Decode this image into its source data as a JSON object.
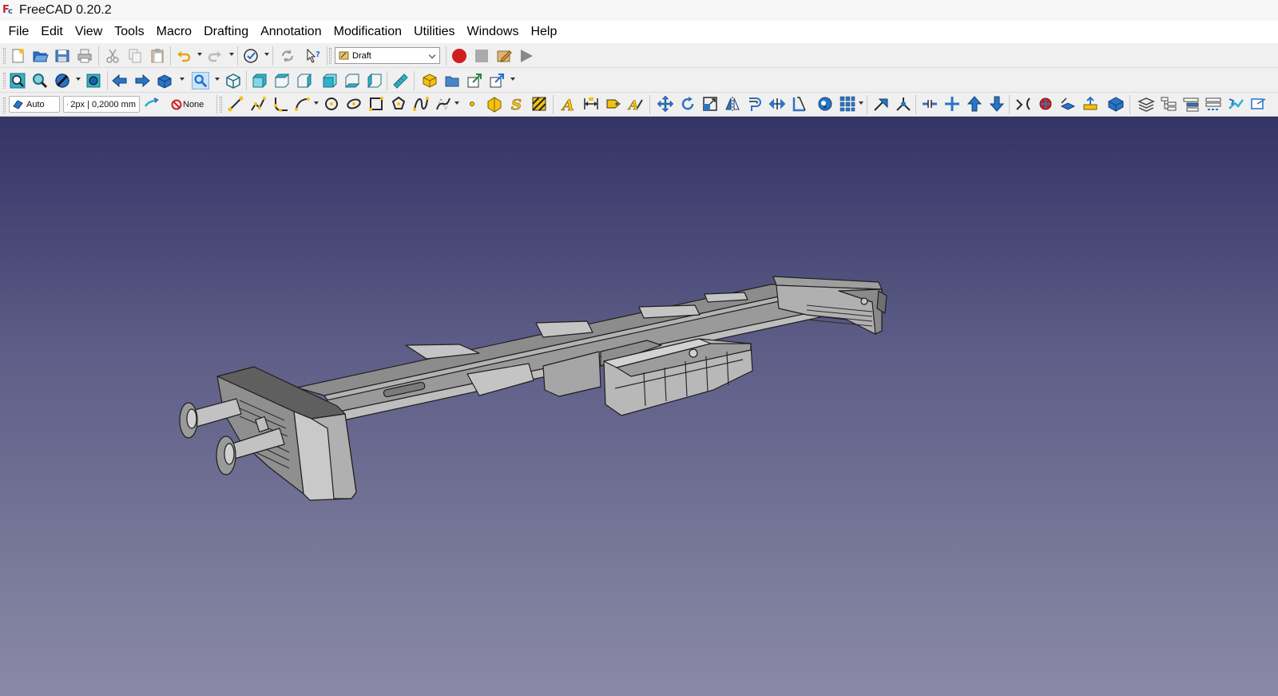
{
  "window": {
    "title": "FreeCAD 0.20.2"
  },
  "menu": [
    "File",
    "Edit",
    "View",
    "Tools",
    "Macro",
    "Drafting",
    "Annotation",
    "Modification",
    "Utilities",
    "Windows",
    "Help"
  ],
  "workbench": {
    "selected": "Draft"
  },
  "draft_tray": {
    "plane_label": "Auto",
    "style_label": "2px | 0,2000 mm",
    "group_label": "None"
  },
  "toolbars": {
    "file": [
      "new-document-icon",
      "open-icon",
      "save-icon",
      "print-icon",
      "cut-icon",
      "copy-icon",
      "paste-icon",
      "undo-icon",
      "redo-icon",
      "refresh-icon",
      "whats-this-icon"
    ],
    "macro": [
      "macro-record-icon",
      "macro-stop-icon",
      "macro-edit-icon",
      "macro-run-icon"
    ],
    "view": [
      "fit-all-icon",
      "fit-selection-icon",
      "draw-style-icon",
      "bounding-box-icon",
      "back-icon",
      "forward-icon",
      "sync-view-icon",
      "standard-views-icon",
      "isometric-icon",
      "front-view-icon",
      "top-view-icon",
      "right-view-icon",
      "rear-view-icon",
      "bottom-view-icon",
      "left-view-icon",
      "measure-distance-icon",
      "create-part-icon",
      "create-group-icon",
      "make-link-icon",
      "link-actions-icon"
    ]
  },
  "colors": {
    "viewport_top": "#333366",
    "viewport_bottom": "#8a8aa6",
    "model_face": "#a9a9a9",
    "model_edge": "#1e1e1e",
    "record_red": "#d01e1e",
    "icon_blue": "#1f6fd1",
    "icon_yellow": "#f5c20b"
  }
}
